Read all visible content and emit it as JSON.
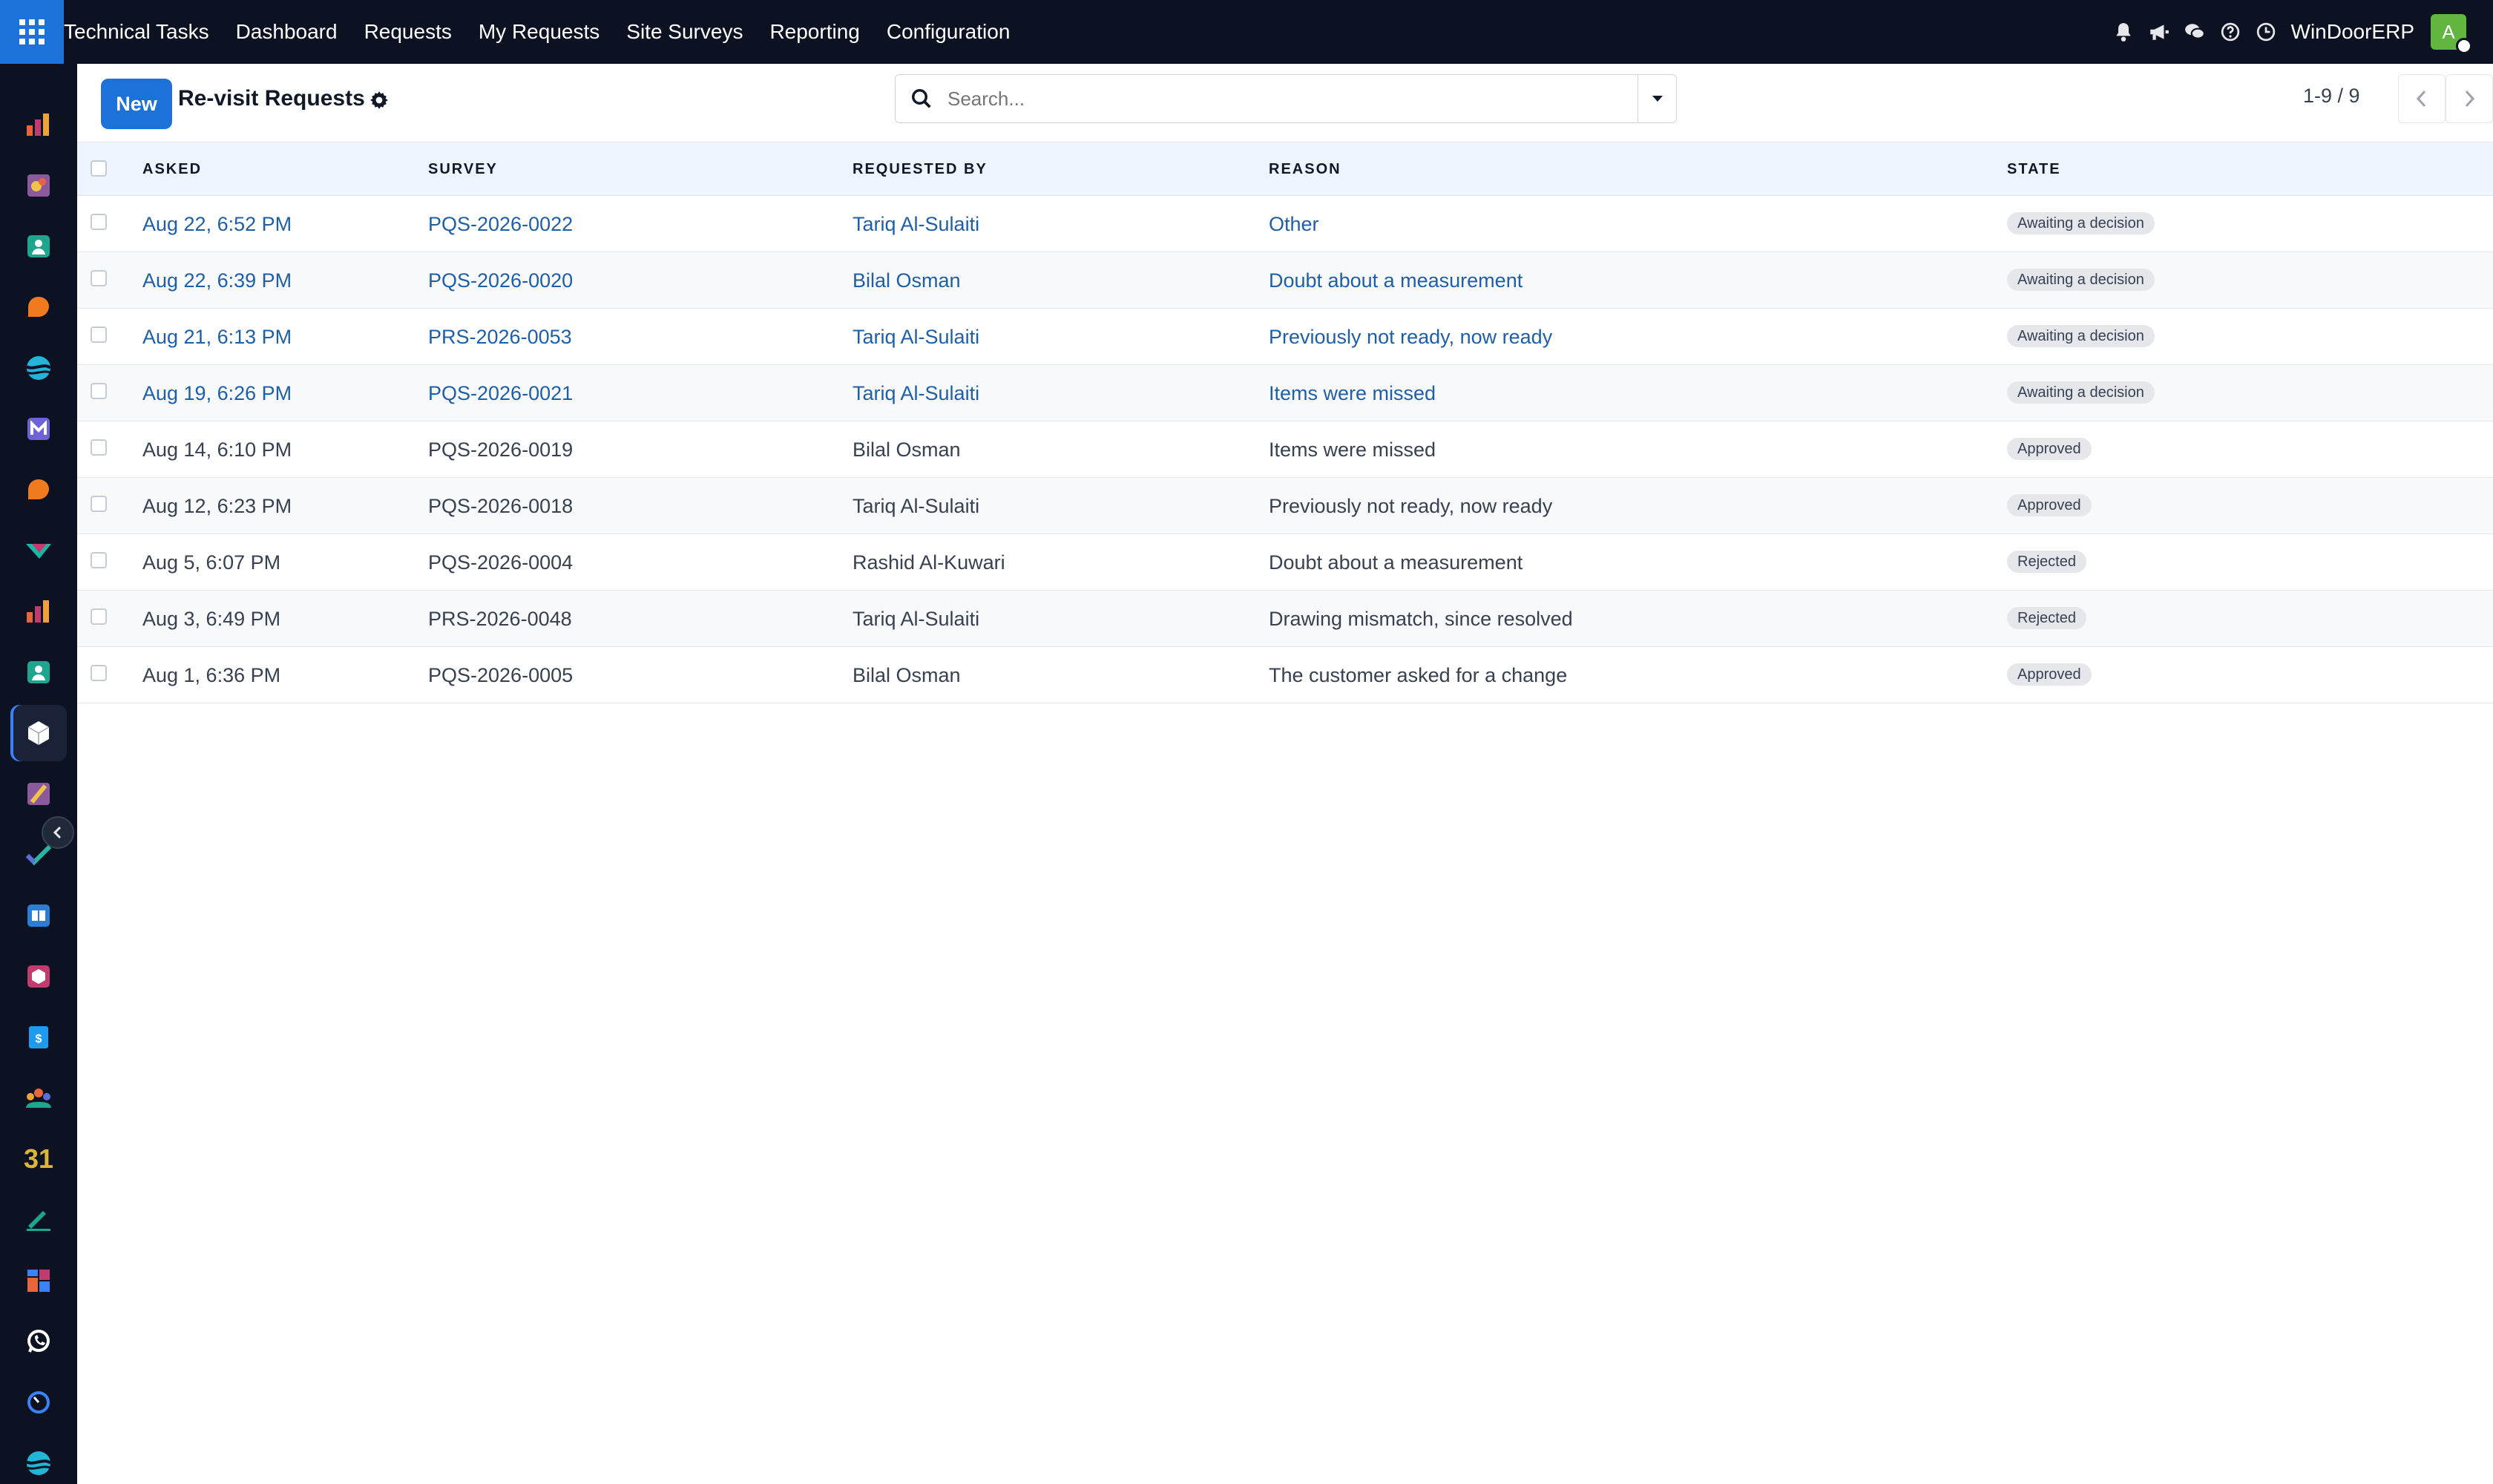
{
  "navbar": {
    "app_name": "Technical Tasks",
    "menu": [
      "Dashboard",
      "Requests",
      "My Requests",
      "Site Surveys",
      "Reporting",
      "Configuration"
    ],
    "company": "WinDoorERP",
    "avatar_letter": "A",
    "icons": [
      "bell-icon",
      "megaphone-icon",
      "chat-icon",
      "help-icon",
      "clock-icon"
    ]
  },
  "control": {
    "new_label": "New",
    "title": "Re-visit Requests",
    "search_placeholder": "Search...",
    "pager": "1-9 / 9"
  },
  "table": {
    "headers": [
      "ASKED",
      "SURVEY",
      "REQUESTED BY",
      "REASON",
      "STATE"
    ],
    "rows": [
      {
        "asked": "Aug 22, 6:52 PM",
        "survey": "PQS-2026-0022",
        "requested_by": "Tariq Al-Sulaiti",
        "reason": "Other",
        "state": "Awaiting a decision"
      },
      {
        "asked": "Aug 22, 6:39 PM",
        "survey": "PQS-2026-0020",
        "requested_by": "Bilal Osman",
        "reason": "Doubt about a measurement",
        "state": "Awaiting a decision"
      },
      {
        "asked": "Aug 21, 6:13 PM",
        "survey": "PRS-2026-0053",
        "requested_by": "Tariq Al-Sulaiti",
        "reason": "Previously not ready, now ready",
        "state": "Awaiting a decision"
      },
      {
        "asked": "Aug 19, 6:26 PM",
        "survey": "PQS-2026-0021",
        "requested_by": "Tariq Al-Sulaiti",
        "reason": "Items were missed",
        "state": "Awaiting a decision"
      },
      {
        "asked": "Aug 14, 6:10 PM",
        "survey": "PQS-2026-0019",
        "requested_by": "Bilal Osman",
        "reason": "Items were missed",
        "state": "Approved"
      },
      {
        "asked": "Aug 12, 6:23 PM",
        "survey": "PQS-2026-0018",
        "requested_by": "Tariq Al-Sulaiti",
        "reason": "Previously not ready, now ready",
        "state": "Approved"
      },
      {
        "asked": "Aug 5, 6:07 PM",
        "survey": "PQS-2026-0004",
        "requested_by": "Rashid Al-Kuwari",
        "reason": "Doubt about a measurement",
        "state": "Rejected"
      },
      {
        "asked": "Aug 3, 6:49 PM",
        "survey": "PRS-2026-0048",
        "requested_by": "Tariq Al-Sulaiti",
        "reason": "Drawing mismatch, since resolved",
        "state": "Rejected"
      },
      {
        "asked": "Aug 1, 6:36 PM",
        "survey": "PQS-2026-0005",
        "requested_by": "Bilal Osman",
        "reason": "The customer asked for a change",
        "state": "Approved"
      }
    ]
  },
  "rail": {
    "calendar_day": "31",
    "items": [
      {
        "icon": "dashboards-icon",
        "color": "#e8663d"
      },
      {
        "icon": "knowledge-icon",
        "color": "#c9a13a"
      },
      {
        "icon": "contacts-icon",
        "color": "#1ea58d"
      },
      {
        "icon": "discuss-icon",
        "color": "#f07a1e"
      },
      {
        "icon": "planning-icon",
        "color": "#22b5d8"
      },
      {
        "icon": "email-marketing-icon",
        "color": "#6d62d8"
      },
      {
        "icon": "livechat-icon",
        "color": "#f07a1e"
      },
      {
        "icon": "field-service-icon",
        "color": "#17b9a4"
      },
      {
        "icon": "reports-icon",
        "color": "#e8663d"
      },
      {
        "icon": "employees-icon",
        "color": "#1ea58d"
      },
      {
        "icon": "technical-tasks-icon",
        "color": "#ffffff"
      },
      {
        "icon": "notes-icon",
        "color": "#c9a13a"
      },
      {
        "icon": "project-icon",
        "color": "#2bb3a3"
      },
      {
        "icon": "documents-icon",
        "color": "#2a7ed8"
      },
      {
        "icon": "inventory-icon",
        "color": "#c23b6f"
      },
      {
        "icon": "invoicing-icon",
        "color": "#1d9bf0"
      },
      {
        "icon": "team-icon",
        "color": "#e8a33d"
      },
      {
        "icon": "calendar-icon",
        "color": "#d9b53a"
      },
      {
        "icon": "sign-icon",
        "color": "#1ea58d"
      },
      {
        "icon": "apps-dashboard-icon",
        "color": "#3b82f6"
      },
      {
        "icon": "whatsapp-icon",
        "color": "#ffffff"
      },
      {
        "icon": "timer-icon",
        "color": "#3b82f6"
      },
      {
        "icon": "planning2-icon",
        "color": "#22b5d8"
      }
    ]
  }
}
